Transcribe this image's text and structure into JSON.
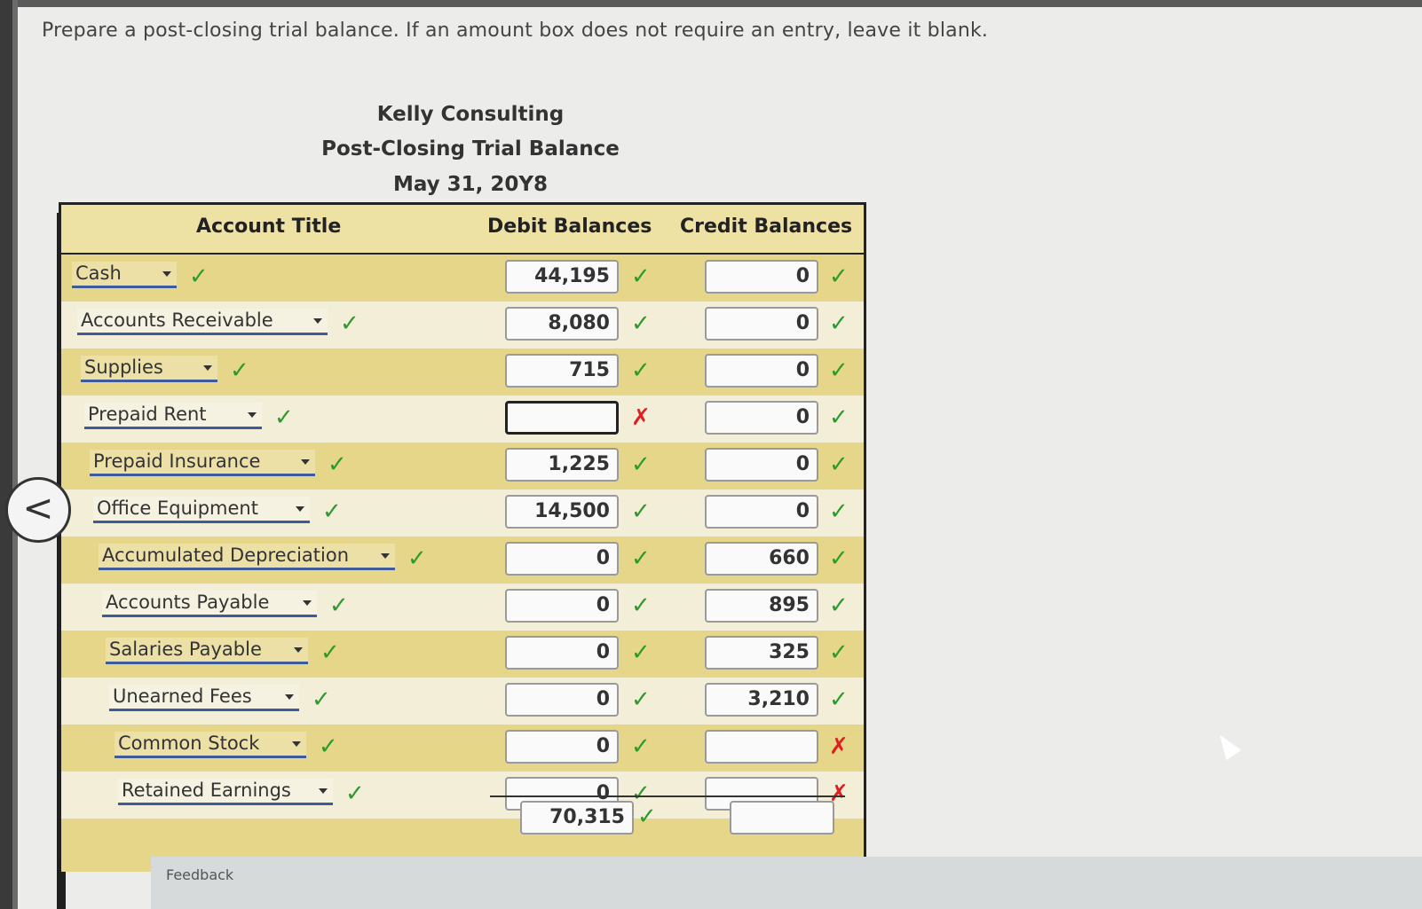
{
  "instructions": "Prepare a post-closing trial balance. If an amount box does not require an entry, leave it blank.",
  "header": {
    "company": "Kelly Consulting",
    "statement": "Post-Closing Trial Balance",
    "date": "May 31, 20Y8"
  },
  "columns": {
    "account": "Account Title",
    "debit": "Debit Balances",
    "credit": "Credit Balances"
  },
  "rows": [
    {
      "account": "Cash",
      "debit": "44,195",
      "debit_status": "correct",
      "credit": "0",
      "credit_status": "correct"
    },
    {
      "account": "Accounts Receivable",
      "debit": "8,080",
      "debit_status": "correct",
      "credit": "0",
      "credit_status": "correct"
    },
    {
      "account": "Supplies",
      "debit": "715",
      "debit_status": "correct",
      "credit": "0",
      "credit_status": "correct"
    },
    {
      "account": "Prepaid Rent",
      "debit": "",
      "debit_status": "incorrect",
      "credit": "0",
      "credit_status": "correct"
    },
    {
      "account": "Prepaid Insurance",
      "debit": "1,225",
      "debit_status": "correct",
      "credit": "0",
      "credit_status": "correct"
    },
    {
      "account": "Office Equipment",
      "debit": "14,500",
      "debit_status": "correct",
      "credit": "0",
      "credit_status": "correct"
    },
    {
      "account": "Accumulated Depreciation",
      "debit": "0",
      "debit_status": "correct",
      "credit": "660",
      "credit_status": "correct"
    },
    {
      "account": "Accounts Payable",
      "debit": "0",
      "debit_status": "correct",
      "credit": "895",
      "credit_status": "correct"
    },
    {
      "account": "Salaries Payable",
      "debit": "0",
      "debit_status": "correct",
      "credit": "325",
      "credit_status": "correct"
    },
    {
      "account": "Unearned Fees",
      "debit": "0",
      "debit_status": "correct",
      "credit": "3,210",
      "credit_status": "correct"
    },
    {
      "account": "Common Stock",
      "debit": "0",
      "debit_status": "correct",
      "credit": "",
      "credit_status": "incorrect"
    },
    {
      "account": "Retained Earnings",
      "debit": "0",
      "debit_status": "correct",
      "credit": "",
      "credit_status": "incorrect"
    }
  ],
  "totals": {
    "debit": "70,315",
    "debit_status": "correct",
    "credit": ""
  },
  "marks": {
    "correct": "✓",
    "incorrect": "✗"
  },
  "nav": {
    "back": "<"
  },
  "feedback": {
    "label": "Feedback"
  },
  "colors": {
    "correct": "#2e9a2e",
    "incorrect": "#e02020",
    "band_dark": "#e6d68a",
    "band_light": "#f2eed8",
    "header_bg": "#ede2a4"
  }
}
